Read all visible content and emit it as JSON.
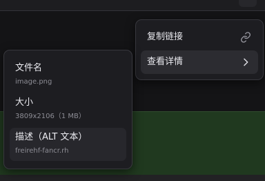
{
  "context_menu": {
    "copy_link_label": "复制链接",
    "copy_link_icon": "link-icon",
    "view_details_label": "查看详情",
    "view_details_icon": "chevron-right-icon"
  },
  "details_panel": {
    "filename_title": "文件名",
    "filename_value": "image.png",
    "size_title": "大小",
    "size_value": "3809x2106（1 MB）",
    "description_title": "描述（ALT 文本）",
    "description_value": "freirehf-fancr.rh"
  }
}
